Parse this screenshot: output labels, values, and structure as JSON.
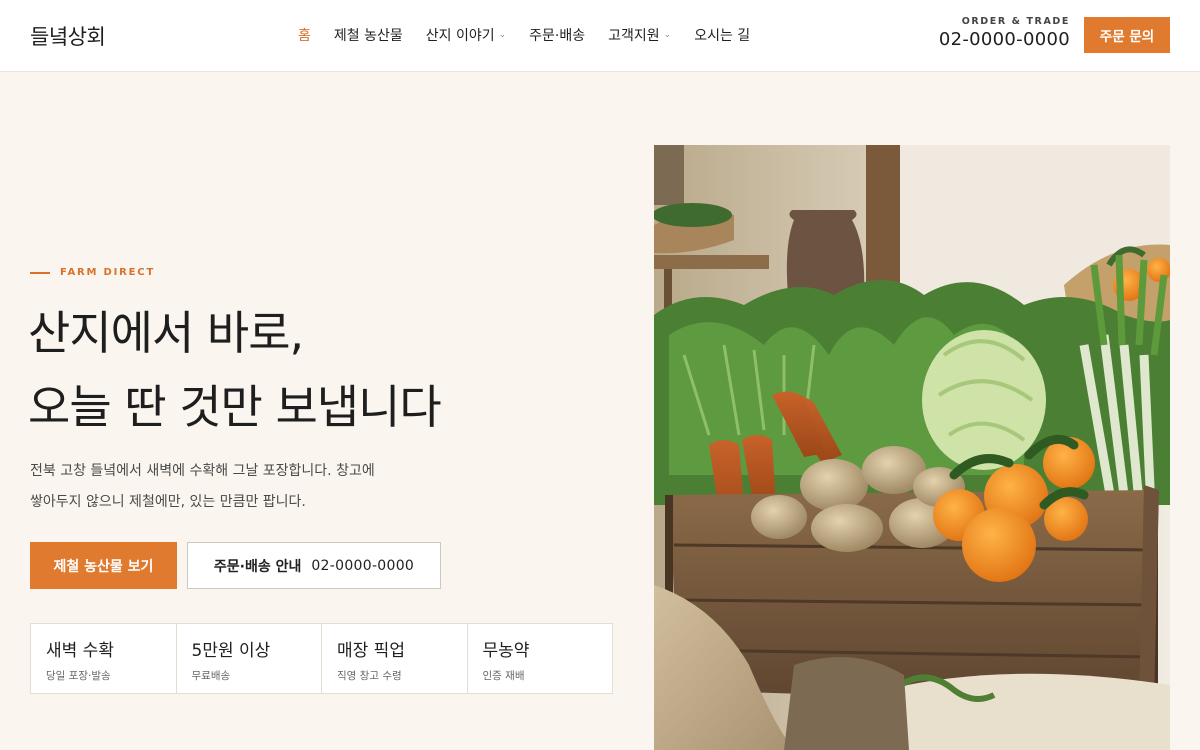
{
  "header": {
    "brand": "들녘상회",
    "nav": [
      {
        "label": "홈",
        "active": true,
        "dropdown": false
      },
      {
        "label": "제철 농산물",
        "active": false,
        "dropdown": false
      },
      {
        "label": "산지 이야기",
        "active": false,
        "dropdown": true
      },
      {
        "label": "주문·배송",
        "active": false,
        "dropdown": false
      },
      {
        "label": "고객지원",
        "active": false,
        "dropdown": true
      },
      {
        "label": "오시는 길",
        "active": false,
        "dropdown": false
      }
    ],
    "contact_label": "ORDER & TRADE",
    "contact_phone": "02-0000-0000",
    "order_button": "주문 문의"
  },
  "hero": {
    "eyebrow": "FARM DIRECT",
    "headline_line1": "산지에서 바로,",
    "headline_line2": "오늘 딴 것만 보냅니다",
    "description_line1": "전북 고창 들녘에서 새벽에 수확해 그날 포장합니다. 창고에",
    "description_line2": "쌓아두지 않으니 제철에만, 있는 만큼만 팝니다.",
    "primary_button": "제철 농산물 보기",
    "secondary_button_label": "주문·배송 안내",
    "secondary_button_phone": "02-0000-0000",
    "features": [
      {
        "title": "새벽 수확",
        "sub": "당일 포장·발송"
      },
      {
        "title": "5만원 이상",
        "sub": "무료배송"
      },
      {
        "title": "매장 픽업",
        "sub": "직영 창고 수령"
      },
      {
        "title": "무농약",
        "sub": "인증 재배"
      }
    ]
  },
  "colors": {
    "accent": "#e07a2e",
    "background": "#faf6ef"
  }
}
